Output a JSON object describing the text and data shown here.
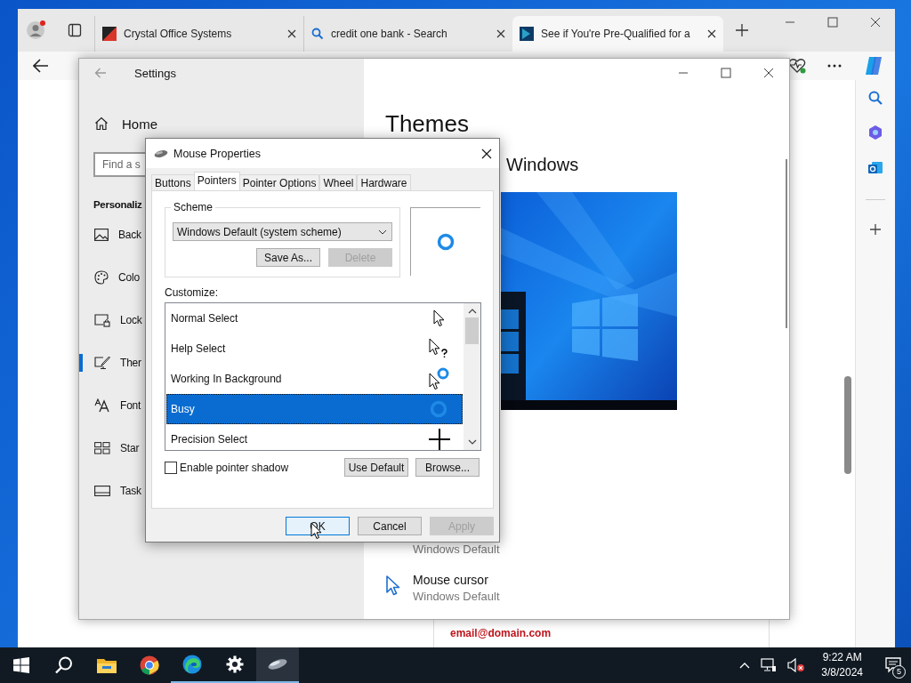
{
  "browser": {
    "tabs": [
      {
        "title": "Crystal Office Systems",
        "kind": "crystal",
        "selected": false
      },
      {
        "title": "credit one bank - Search",
        "kind": "search",
        "selected": false
      },
      {
        "title": "See if You're Pre-Qualified for a",
        "kind": "bank",
        "selected": true
      }
    ]
  },
  "page": {
    "email": "email@domain.com"
  },
  "settings": {
    "title": "Settings",
    "home": "Home",
    "search_placeholder": "Find a s",
    "section": "Personaliz",
    "nav": [
      {
        "label": "Back",
        "kind": "background",
        "selected": false
      },
      {
        "label": "Colo",
        "kind": "palette",
        "selected": false
      },
      {
        "label": "Lock",
        "kind": "lock",
        "selected": false
      },
      {
        "label": "Ther",
        "kind": "themes",
        "selected": true
      },
      {
        "label": "Font",
        "kind": "fonts",
        "selected": false
      },
      {
        "label": "Star",
        "kind": "start",
        "selected": false
      },
      {
        "label": "Task",
        "kind": "taskbar",
        "selected": false
      }
    ],
    "heading": "Themes",
    "current_theme": "Windows",
    "items": [
      {
        "subtitle": "Windows Default"
      },
      {
        "title": "Mouse cursor",
        "subtitle": "Windows Default",
        "kind": "cursor"
      }
    ]
  },
  "dialog": {
    "title": "Mouse Properties",
    "tabs": [
      {
        "label": "Buttons",
        "selected": false
      },
      {
        "label": "Pointers",
        "selected": true
      },
      {
        "label": "Pointer Options",
        "selected": false
      },
      {
        "label": "Wheel",
        "selected": false
      },
      {
        "label": "Hardware",
        "selected": false
      }
    ],
    "scheme_label": "Scheme",
    "scheme_value": "Windows Default (system scheme)",
    "scheme_buttons": [
      {
        "label": "Save As...",
        "disabled": false
      },
      {
        "label": "Delete",
        "disabled": true
      }
    ],
    "customize_label": "Customize:",
    "cursors": [
      {
        "name": "Normal Select",
        "kind": "arrow",
        "selected": false
      },
      {
        "name": "Help Select",
        "kind": "help",
        "selected": false
      },
      {
        "name": "Working In Background",
        "kind": "working",
        "selected": false
      },
      {
        "name": "Busy",
        "kind": "busy",
        "selected": true
      },
      {
        "name": "Precision Select",
        "kind": "cross",
        "selected": false
      }
    ],
    "pointer_shadow": {
      "label": "Enable pointer shadow",
      "checked": false
    },
    "list_buttons": [
      "Use Default",
      "Browse..."
    ],
    "buttons": [
      {
        "label": "OK",
        "disabled": false,
        "focused": true
      },
      {
        "label": "Cancel",
        "disabled": false,
        "focused": false
      },
      {
        "label": "Apply",
        "disabled": true,
        "focused": false
      }
    ]
  },
  "taskbar": {
    "apps": [
      {
        "kind": "start",
        "running": false,
        "active": false
      },
      {
        "kind": "search",
        "running": false,
        "active": false
      },
      {
        "kind": "explorer",
        "running": false,
        "active": false
      },
      {
        "kind": "chrome",
        "running": false,
        "active": false
      },
      {
        "kind": "edge",
        "running": true,
        "active": false
      },
      {
        "kind": "settings",
        "running": true,
        "active": false
      },
      {
        "kind": "mouse",
        "running": true,
        "active": true
      }
    ],
    "time": "9:22 AM",
    "date": "3/8/2024",
    "notifications": "5"
  }
}
